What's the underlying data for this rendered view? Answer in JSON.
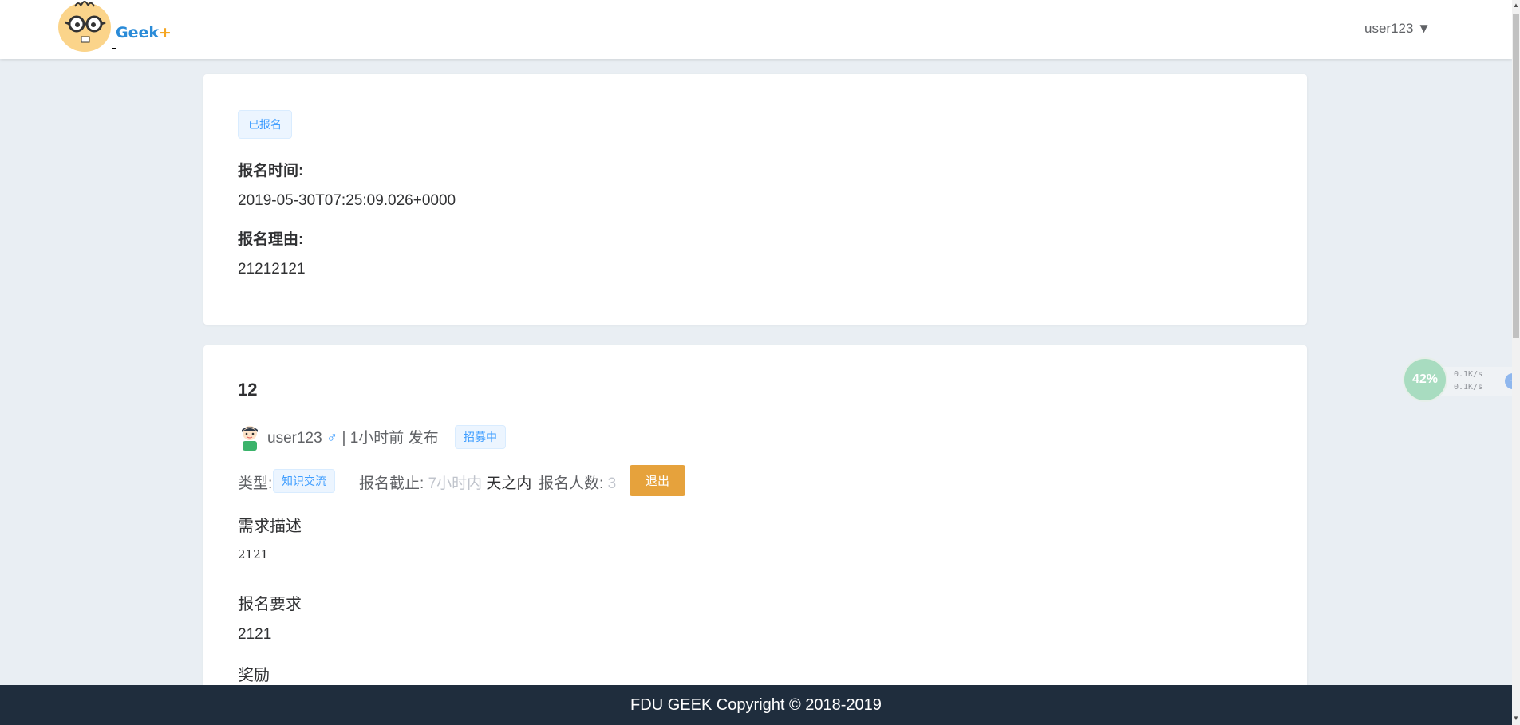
{
  "header": {
    "logo_text": "Geek",
    "logo_plus": "+",
    "user_menu": "user123 ▼"
  },
  "registration": {
    "status_tag": "已报名",
    "time_label": "报名时间:",
    "time_value": "2019-05-30T07:25:09.026+0000",
    "reason_label": "报名理由:",
    "reason_value": "21212121"
  },
  "activity": {
    "title": "12",
    "author": "user123",
    "gender_symbol": "♂",
    "separator": "|",
    "posted_time": "1小时前",
    "posted_suffix": "发布",
    "recruit_tag": "招募中",
    "type_label": "类型:",
    "type_tag": "知识交流",
    "deadline_label": "报名截止:",
    "deadline_value": "7小时内",
    "deadline_suffix": "天之内",
    "count_label": "报名人数:",
    "count_value": "3",
    "quit_button": "退出",
    "desc_heading": "需求描述",
    "desc_value": "2121",
    "req_heading": "报名要求",
    "req_value": "2121",
    "reward_heading": "奖励"
  },
  "footer": {
    "text": "FDU GEEK Copyright © 2018-2019"
  },
  "widget": {
    "percent": "42%",
    "upload": "0.1K/s",
    "download": "0.1K/s",
    "plus": "+"
  },
  "colors": {
    "accent": "#409eff",
    "warning": "#e6a23c",
    "footer_bg": "#1f2d3d",
    "page_bg": "#e9eef3"
  }
}
